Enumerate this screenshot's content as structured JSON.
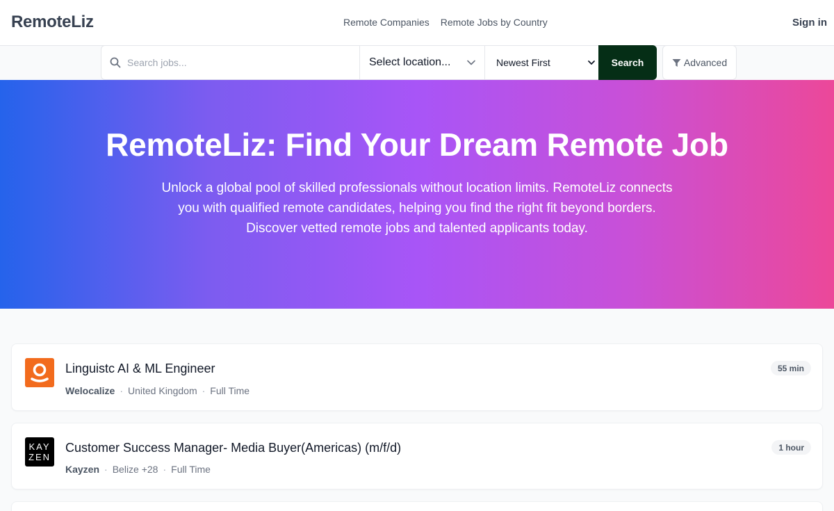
{
  "header": {
    "logo": "RemoteLiz",
    "nav": [
      {
        "label": "Remote Companies"
      },
      {
        "label": "Remote Jobs by Country"
      }
    ],
    "signin_label": "Sign in"
  },
  "search": {
    "placeholder": "Search jobs...",
    "query": "",
    "search_icon": "search-icon",
    "location_label": "Select location...",
    "sort_label": "Newest First",
    "search_button": "Search",
    "advanced_label": "Advanced",
    "advanced_icon": "filter-icon"
  },
  "hero": {
    "title": "RemoteLiz: Find Your Dream Remote Job",
    "subtitle": "Unlock a global pool of skilled professionals without location limits. RemoteLiz connects you with qualified remote candidates, helping you find the right fit beyond borders. Discover vetted remote jobs and talented applicants today."
  },
  "jobs": [
    {
      "title": "Linguistc AI & ML Engineer",
      "company": "Welocalize",
      "location": "United Kingdom",
      "type": "Full Time",
      "age": "55 min",
      "logo_color": "#f26b1d"
    },
    {
      "title": "Customer Success Manager- Media Buyer(Americas) (m/f/d)",
      "company": "Kayzen",
      "location": "Belize +28",
      "type": "Full Time",
      "age": "1 hour",
      "logo_text_top": "KAY",
      "logo_text_bottom": "ZEN",
      "logo_color": "#000000"
    }
  ],
  "colors": {
    "search_button_bg": "#052e16",
    "hero_gradient_start": "#2563eb",
    "hero_gradient_mid": "#a855f7",
    "hero_gradient_end": "#ec4899"
  }
}
